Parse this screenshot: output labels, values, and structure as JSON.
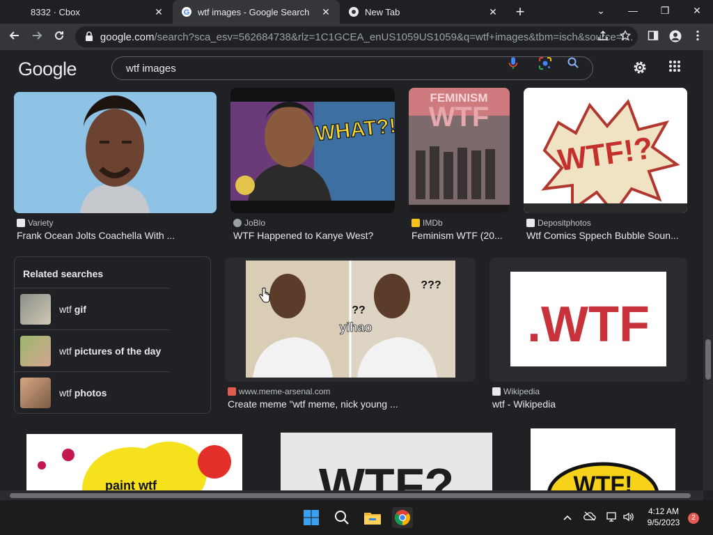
{
  "browser": {
    "tabs": [
      {
        "title": "8332 · Cbox",
        "active": false
      },
      {
        "title": "wtf images - Google Search",
        "active": true
      },
      {
        "title": "New Tab",
        "active": false
      }
    ],
    "close_glyph": "✕",
    "new_tab_glyph": "+",
    "window_controls": {
      "collapse": "⌄",
      "minimize": "—",
      "restore": "❐",
      "close": "✕"
    },
    "address": {
      "host": "google.com",
      "rest": "/search?sca_esv=562684738&rlz=1C1GCEA_enUS1059US1059&q=wtf+images&tbm=isch&source=l..."
    }
  },
  "google": {
    "logo": "Google",
    "query": "wtf images",
    "colors": {
      "blue": "#4285f4",
      "red": "#ea4335",
      "yellow": "#fbbc05",
      "green": "#34a853"
    }
  },
  "results": [
    {
      "source": "Variety",
      "title": "Frank Ocean Jolts Coachella With ..."
    },
    {
      "source": "JoBlo",
      "title": "WTF Happened to Kanye West?"
    },
    {
      "source": "IMDb",
      "title": "Feminism WTF (20..."
    },
    {
      "source": "Depositphotos",
      "title": "Wtf Comics Sppech Bubble Soun..."
    },
    {
      "source": "www.meme-arsenal.com",
      "title": "Create meme \"wtf meme, nick young ..."
    },
    {
      "source": "Wikipedia",
      "title": "wtf - Wikipedia"
    }
  ],
  "image_text": {
    "what": "WHAT?!",
    "feminism": "FEMINISM",
    "wtf": "WTF",
    "wtf_comic": "WTF!?",
    "wtf_wiki": ".WTF",
    "meme_q1": "???",
    "meme_q2": "??",
    "meme_caption": "yihao",
    "paint_wtf": "paint wtf",
    "wtf_q": "WTF?",
    "wtf_bang": "WTF!"
  },
  "related": {
    "heading": "Related searches",
    "items": [
      {
        "prefix": "wtf",
        "bold": "gif"
      },
      {
        "prefix": "wtf",
        "bold": "pictures of the day"
      },
      {
        "prefix": "wtf",
        "bold": "photos"
      }
    ]
  },
  "taskbar": {
    "time": "4:12 AM",
    "date": "9/5/2023",
    "notifications": "2"
  }
}
